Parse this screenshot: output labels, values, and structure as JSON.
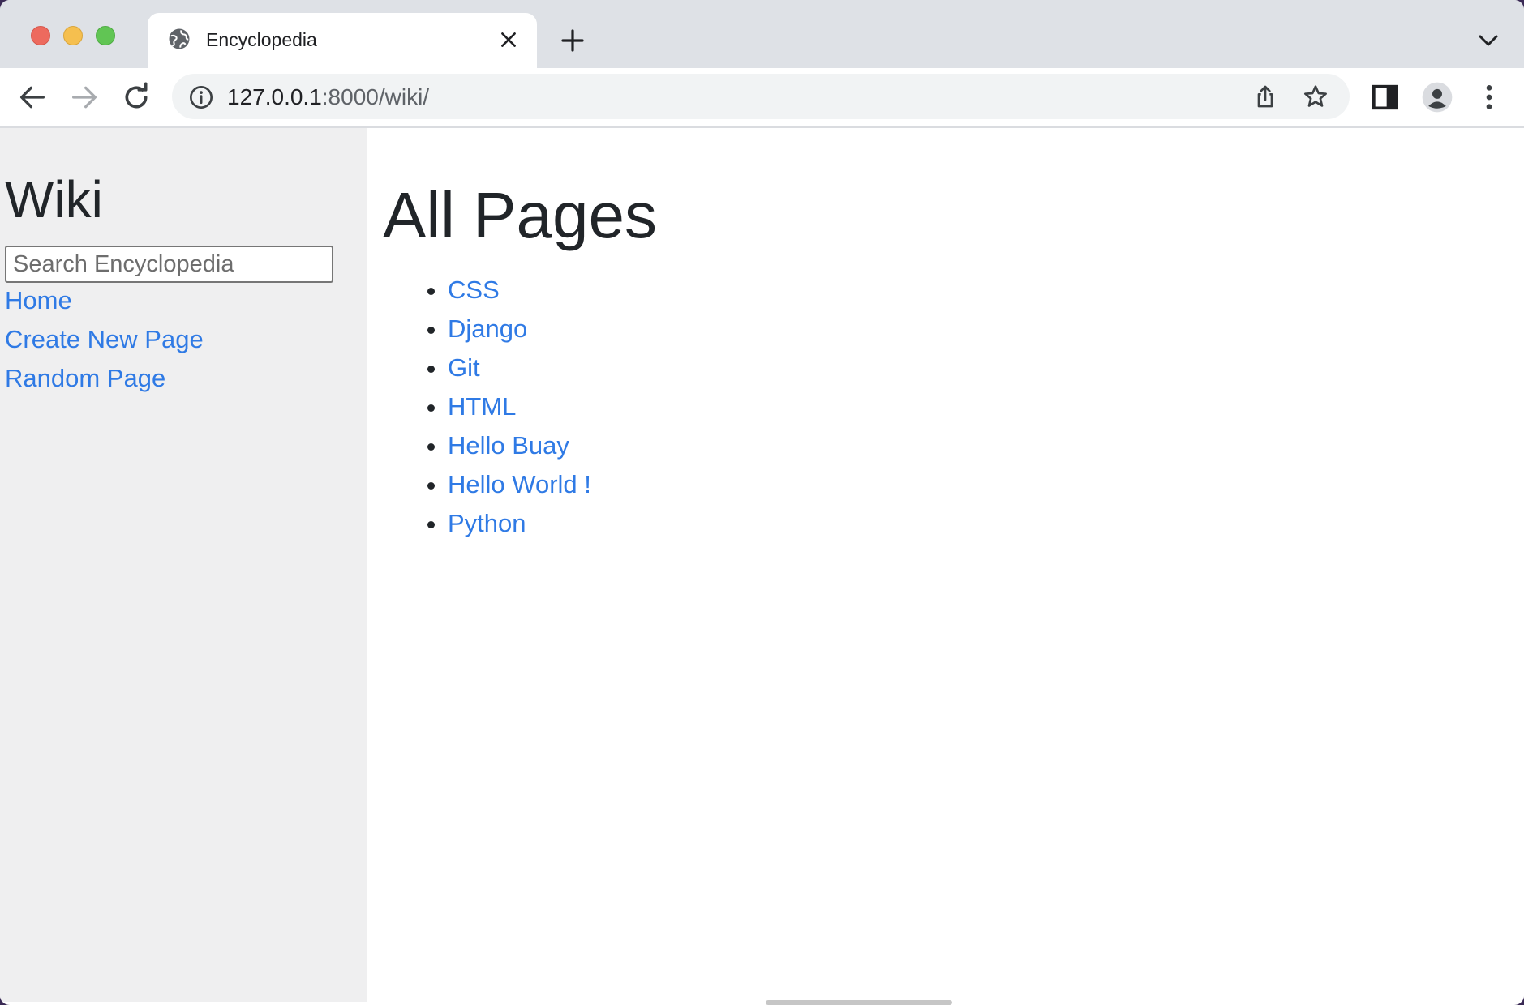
{
  "browser": {
    "tab": {
      "title": "Encyclopedia",
      "favicon": "globe-icon",
      "close": "close-icon"
    },
    "new_tab": "plus-icon",
    "tab_menu": "chevron-down-icon",
    "toolbar": {
      "back": "arrow-left-icon",
      "forward": "arrow-right-icon",
      "reload": "reload-icon",
      "site_info": "info-icon",
      "share": "share-icon",
      "bookmark": "star-icon",
      "side_panel": "side-panel-icon",
      "profile": "profile-icon",
      "menu": "more-vertical-icon"
    },
    "url": {
      "host": "127.0.0.1",
      "path": ":8000/wiki/"
    },
    "traffic_light_colors": [
      "#ed6a5e",
      "#f5bf4f",
      "#61c554"
    ]
  },
  "sidebar": {
    "title": "Wiki",
    "search": {
      "placeholder": "Search Encyclopedia",
      "value": ""
    },
    "links": [
      {
        "label": "Home"
      },
      {
        "label": "Create New Page"
      },
      {
        "label": "Random Page"
      }
    ],
    "background": "#efeff0"
  },
  "main": {
    "title": "All Pages",
    "entries": [
      {
        "label": "CSS"
      },
      {
        "label": "Django"
      },
      {
        "label": "Git"
      },
      {
        "label": "HTML"
      },
      {
        "label": "Hello Buay"
      },
      {
        "label": "Hello World !"
      },
      {
        "label": "Python"
      }
    ]
  },
  "colors": {
    "link": "#2f7ae5",
    "text": "#212529"
  }
}
